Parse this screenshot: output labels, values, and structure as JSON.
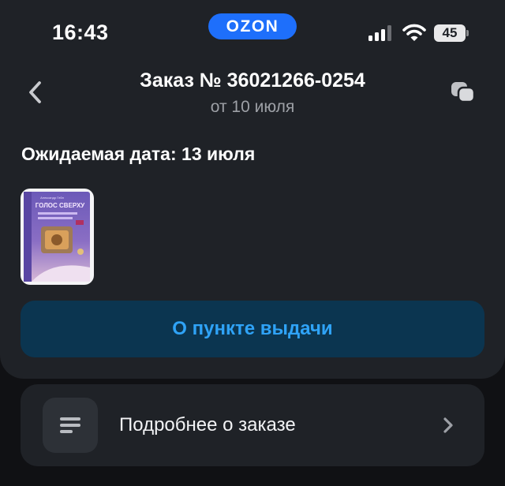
{
  "status_bar": {
    "time": "16:43",
    "battery_level": "45",
    "signal_icon": "cellular-signal-icon",
    "wifi_icon": "wifi-icon"
  },
  "app": {
    "logo_text": "OZON",
    "brand_color": "#1e6ffb"
  },
  "header": {
    "back_icon": "chevron-left-icon",
    "title": "Заказ № 36021266-0254",
    "subtitle": "от 10 июля",
    "chat_icon": "chat-bubbles-icon"
  },
  "order": {
    "expected_date": "Ожидаемая дата: 13 июля",
    "product_cover_title": "ГОЛОС СВЕРХУ",
    "product_cover_author": "Александр Гейл"
  },
  "actions": {
    "pickup_point_label": "О пункте выдачи",
    "pickup_point_text_color": "#2fa3f7"
  },
  "details": {
    "label": "Подробнее о заказе",
    "icon": "list-lines-icon",
    "chevron_icon": "chevron-right-icon"
  }
}
